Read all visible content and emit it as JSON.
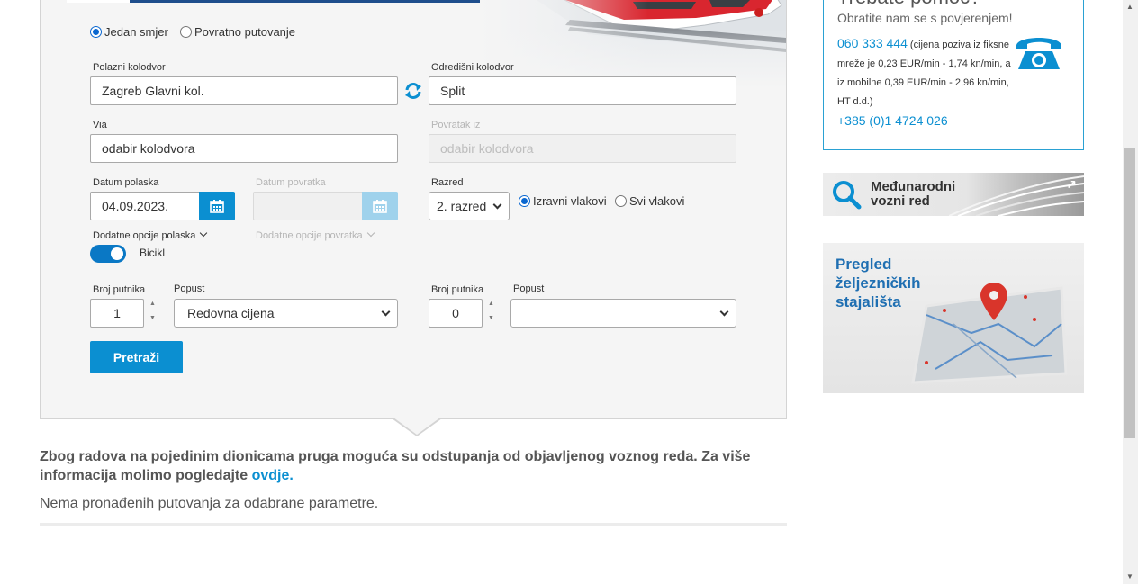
{
  "search": {
    "trip_type": {
      "one_way": "Jedan smjer",
      "return": "Povratno putovanje"
    },
    "departure_station": {
      "label": "Polazni kolodvor",
      "value": "Zagreb Glavni kol."
    },
    "arrival_station": {
      "label": "Odredišni kolodvor",
      "value": "Split"
    },
    "via": {
      "label": "Via",
      "placeholder": "odabir kolodvora"
    },
    "return_from": {
      "label": "Povratak iz",
      "placeholder": "odabir kolodvora"
    },
    "departure_date": {
      "label": "Datum polaska",
      "value": "04.09.2023."
    },
    "return_date": {
      "label": "Datum povratka"
    },
    "class": {
      "label": "Razred",
      "value": "2. razred"
    },
    "train_filter": {
      "direct": "Izravni vlakovi",
      "all": "Svi vlakovi"
    },
    "extra_departure": {
      "label": "Dodatne opcije polaska",
      "toggle_label": "Bicikl"
    },
    "extra_return": {
      "label": "Dodatne opcije povratka"
    },
    "passengers_out": {
      "label": "Broj putnika",
      "value": "1"
    },
    "discount_out": {
      "label": "Popust",
      "value": "Redovna cijena"
    },
    "passengers_ret": {
      "label": "Broj putnika",
      "value": "0"
    },
    "discount_ret": {
      "label": "Popust",
      "value": ""
    },
    "search_button": "Pretraži"
  },
  "notice": {
    "text": "Zbog radova na pojedinim dionicama pruga moguća su odstupanja od objavljenog voznog reda. Za više informacija molimo pogledajte ",
    "link": "ovdje."
  },
  "no_results": "Nema pronađenih putovanja za odabrane parametre.",
  "help": {
    "title": "Trebate pomoć?",
    "subtitle": "Obratite nam se s povjerenjem!",
    "phone": "060 333 444",
    "phone_note": " (cijena poziva iz fiksne mreže je 0,23 EUR/min - 1,74 kn/min, a iz mobilne 0,39 EUR/min - 2,96 kn/min, HT d.d.)",
    "phone2": "+385 (0)1 4724 026"
  },
  "international": {
    "line1": "Međunarodni",
    "line2": "vozni red"
  },
  "stations": {
    "line1": "Pregled",
    "line2": "željezničkih",
    "line3": "stajališta"
  },
  "colors": {
    "primary": "#0b8fd1",
    "navy": "#1f4e8c",
    "help_border": "#2aa1d3"
  }
}
